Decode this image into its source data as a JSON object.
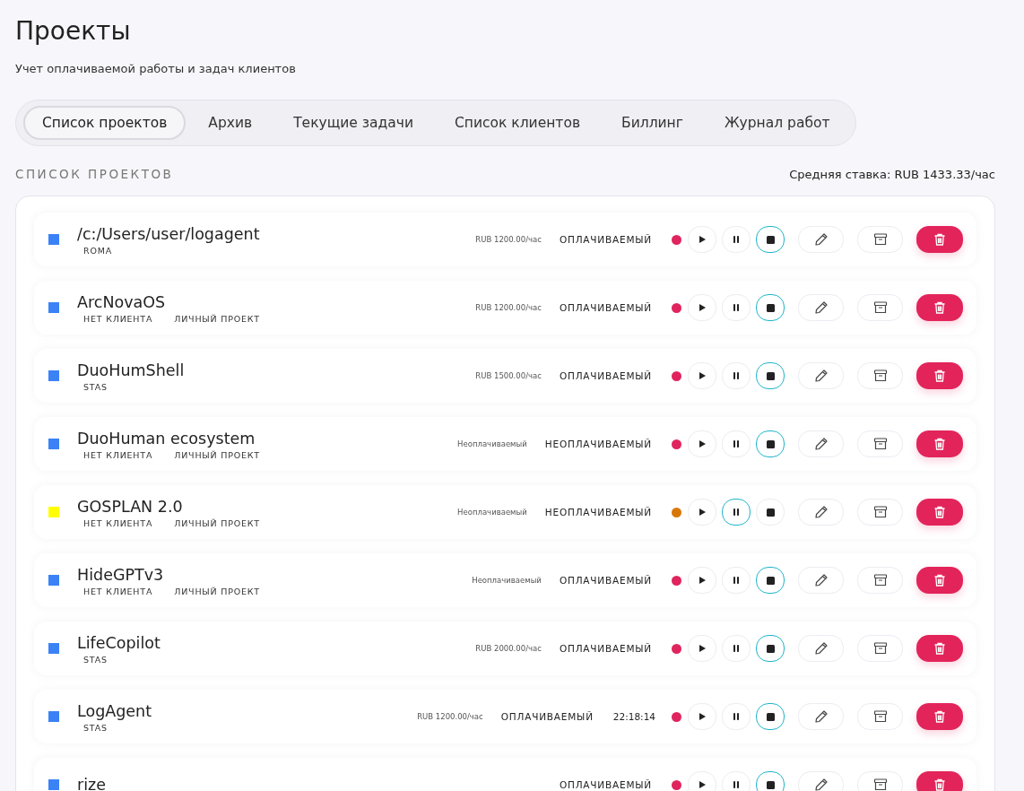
{
  "page": {
    "title": "Проекты",
    "subtitle": "Учет оплачиваемой работы и задач клиентов"
  },
  "tabs": [
    {
      "label": "Список проектов",
      "selected": true
    },
    {
      "label": "Архив",
      "selected": false
    },
    {
      "label": "Текущие задачи",
      "selected": false
    },
    {
      "label": "Список клиентов",
      "selected": false
    },
    {
      "label": "Биллинг",
      "selected": false
    },
    {
      "label": "Журнал работ",
      "selected": false
    }
  ],
  "section": {
    "heading": "СПИСОК ПРОЕКТОВ",
    "average_rate": "Средняя ставка: RUB 1433.33/час"
  },
  "projects": [
    {
      "name": "/c:/Users/user/logagent",
      "color": "#3b82f6",
      "tags": [
        "ROMA"
      ],
      "rate": "RUB 1200.00/час",
      "billing": "ОПЛАЧИВАЕМЫЙ",
      "paused": false,
      "stopped": true
    },
    {
      "name": "ArcNovaOS",
      "color": "#3b82f6",
      "tags": [
        "НЕТ КЛИЕНТА",
        "ЛИЧНЫЙ ПРОЕКТ"
      ],
      "rate": "RUB 1200.00/час",
      "billing": "ОПЛАЧИВАЕМЫЙ",
      "paused": false,
      "stopped": true
    },
    {
      "name": "DuoHumShell",
      "color": "#3b82f6",
      "tags": [
        "STAS"
      ],
      "rate": "RUB 1500.00/час",
      "billing": "ОПЛАЧИВАЕМЫЙ",
      "paused": false,
      "stopped": true
    },
    {
      "name": "DuoHuman ecosystem",
      "color": "#3b82f6",
      "tags": [
        "НЕТ КЛИЕНТА",
        "ЛИЧНЫЙ ПРОЕКТ"
      ],
      "rate": "Неоплачиваемый",
      "billing": "НЕОПЛАЧИВАЕМЫЙ",
      "paused": false,
      "stopped": true
    },
    {
      "name": "GOSPLAN 2.0",
      "color": "#ffff00",
      "tags": [
        "НЕТ КЛИЕНТА",
        "ЛИЧНЫЙ ПРОЕКТ"
      ],
      "rate": "Неоплачиваемый",
      "billing": "НЕОПЛАЧИВАЕМЫЙ",
      "paused": true,
      "stopped": false
    },
    {
      "name": "HideGPTv3",
      "color": "#3b82f6",
      "tags": [
        "НЕТ КЛИЕНТА",
        "ЛИЧНЫЙ ПРОЕКТ"
      ],
      "rate": "Неоплачиваемый",
      "billing": "ОПЛАЧИВАЕМЫЙ",
      "paused": false,
      "stopped": true
    },
    {
      "name": "LifeCopilot",
      "color": "#3b82f6",
      "tags": [
        "STAS"
      ],
      "rate": "RUB 2000.00/час",
      "billing": "ОПЛАЧИВАЕМЫЙ",
      "paused": false,
      "stopped": true
    },
    {
      "name": "LogAgent",
      "color": "#3b82f6",
      "tags": [
        "STAS"
      ],
      "rate": "RUB 1200.00/час",
      "billing": "ОПЛАЧИВАЕМЫЙ",
      "time": "22:18:14",
      "paused": false,
      "stopped": true
    },
    {
      "name": "rize",
      "color": "#3b82f6",
      "billing": "ОПЛАЧИВАЕМЫЙ",
      "paused": false,
      "stopped": true
    }
  ]
}
